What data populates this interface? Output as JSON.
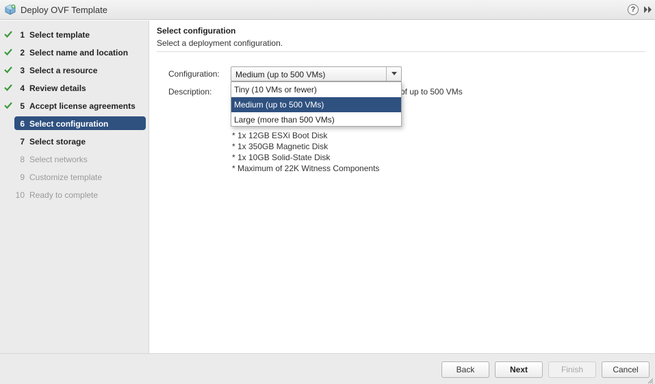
{
  "window": {
    "title": "Deploy OVF Template",
    "help_label": "?"
  },
  "steps": [
    {
      "num": "1",
      "label": "Select template",
      "state": "done"
    },
    {
      "num": "2",
      "label": "Select name and location",
      "state": "done"
    },
    {
      "num": "3",
      "label": "Select a resource",
      "state": "done"
    },
    {
      "num": "4",
      "label": "Review details",
      "state": "done"
    },
    {
      "num": "5",
      "label": "Accept license agreements",
      "state": "done"
    },
    {
      "num": "6",
      "label": "Select configuration",
      "state": "active"
    },
    {
      "num": "7",
      "label": "Select storage",
      "state": "todo"
    },
    {
      "num": "8",
      "label": "Select networks",
      "state": "disabled"
    },
    {
      "num": "9",
      "label": "Customize template",
      "state": "disabled"
    },
    {
      "num": "10",
      "label": "Ready to complete",
      "state": "disabled"
    }
  ],
  "main": {
    "title": "Select configuration",
    "subtitle": "Select a deployment configuration.",
    "configuration_label": "Configuration:",
    "configuration_value": "Medium (up to 500 VMs)",
    "description_label": "Description:",
    "description_visible_fragment": "of up to 500 VMs",
    "description_lines": [
      "* 1x 12GB ESXi Boot Disk",
      "* 1x 350GB Magnetic Disk",
      "* 1x 10GB Solid-State Disk",
      "* Maximum of 22K Witness Components"
    ],
    "dropdown_options": [
      {
        "label": "Tiny (10 VMs or fewer)",
        "selected": false
      },
      {
        "label": "Medium (up to 500 VMs)",
        "selected": true
      },
      {
        "label": "Large (more than 500 VMs)",
        "selected": false
      }
    ]
  },
  "footer": {
    "back_label": "Back",
    "next_label": "Next",
    "finish_label": "Finish",
    "cancel_label": "Cancel"
  },
  "colors": {
    "accent": "#2f5180",
    "check": "#3a9a3a",
    "sidebar_bg": "#ebebeb"
  }
}
